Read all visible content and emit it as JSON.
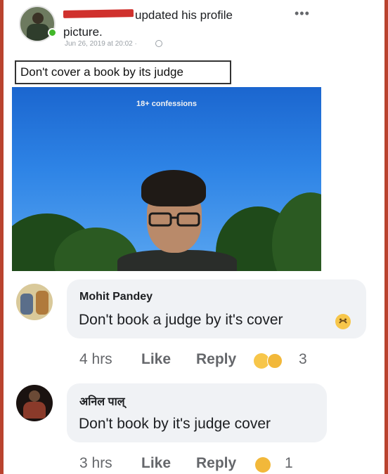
{
  "post": {
    "author_action": "updated his profile picture.",
    "timestamp": "Jun 26, 2019 at 20:02 ·",
    "caption": "Don't cover a book by its judge",
    "watermark": "18+ confessions"
  },
  "comments": [
    {
      "name": "Mohit Pandey",
      "text": "Don't book a judge by it's cover",
      "time": "4 hrs",
      "like_label": "Like",
      "reply_label": "Reply",
      "reaction_count": "3"
    },
    {
      "name": "अनिल पाल्",
      "text": "Don't book by it's judge cover",
      "time": "3 hrs",
      "like_label": "Like",
      "reply_label": "Reply",
      "reaction_count": "1"
    }
  ],
  "colors": {
    "frame_border": "#b9432f",
    "redaction": "#d0312d",
    "online": "#42b72a",
    "bubble": "#f0f2f5"
  },
  "icons": [
    "avatar",
    "online-dot",
    "globe-icon",
    "more-icon",
    "upside-down-face-emoji",
    "haha-emoji",
    "sad-emoji"
  ]
}
